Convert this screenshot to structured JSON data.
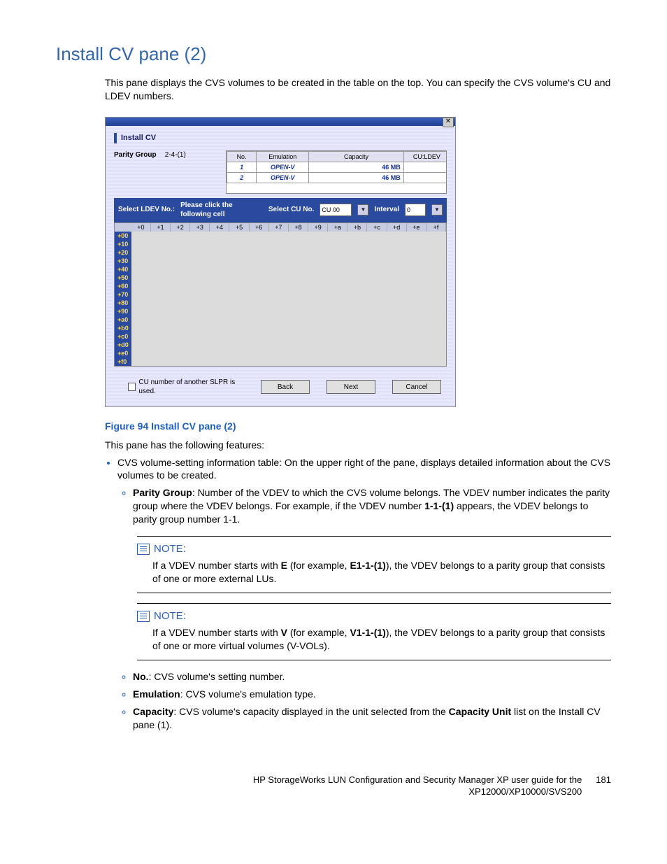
{
  "heading": "Install CV pane (2)",
  "intro": "This pane displays the CVS volumes to be created in the table on the top. You can specify the CVS volume's CU and LDEV numbers.",
  "dialog": {
    "title": "Install CV",
    "parity_label": "Parity Group",
    "parity_value": "2-4-(1)",
    "cols": {
      "no": "No.",
      "emu": "Emulation",
      "cap": "Capacity",
      "culdev": "CU:LDEV"
    },
    "rows": [
      {
        "no": "1",
        "emu": "OPEN-V",
        "cap": "46 MB",
        "culdev": ""
      },
      {
        "no": "2",
        "emu": "OPEN-V",
        "cap": "46 MB",
        "culdev": ""
      }
    ],
    "select_ldev_label": "Select LDEV No.:",
    "click_cell": "Please click the following cell",
    "select_cu_label": "Select CU No.",
    "cu_value": "CU 00",
    "interval_label": "Interval",
    "interval_value": "0",
    "col_offsets": [
      "+0",
      "+1",
      "+2",
      "+3",
      "+4",
      "+5",
      "+6",
      "+7",
      "+8",
      "+9",
      "+a",
      "+b",
      "+c",
      "+d",
      "+e",
      "+f"
    ],
    "row_offsets": [
      "+00",
      "+10",
      "+20",
      "+30",
      "+40",
      "+50",
      "+60",
      "+70",
      "+80",
      "+90",
      "+a0",
      "+b0",
      "+c0",
      "+d0",
      "+e0",
      "+f0"
    ],
    "chk_label": "CU number of another SLPR is used.",
    "btn_back": "Back",
    "btn_next": "Next",
    "btn_cancel": "Cancel"
  },
  "figcap": "Figure 94 Install CV pane (2)",
  "features_lead": "This pane has the following features:",
  "bul_cvs_info": "CVS volume-setting information table: On the upper right of the pane, displays detailed information about the CVS volumes to be created.",
  "pg_label": "Parity Group",
  "pg_rest1": ": Number of the VDEV to which the CVS volume belongs. The VDEV number indicates the parity group where the VDEV belongs. For example, if the VDEV number ",
  "pg_bold": "1-1-(1)",
  "pg_rest2": " appears, the VDEV belongs to parity group number 1-1.",
  "note_label": "NOTE:",
  "note1a": "If a VDEV number starts with ",
  "note1b": "E",
  "note1c": " (for example, ",
  "note1d": "E1-1-(1)",
  "note1e": "), the VDEV belongs to a parity group that consists of one or more external LUs.",
  "note2a": "If a VDEV number starts with ",
  "note2b": "V",
  "note2c": " (for example, ",
  "note2d": "V1-1-(1)",
  "note2e": "), the VDEV belongs to a parity group that consists of one or more virtual volumes (V-VOLs).",
  "li_no_b": "No.",
  "li_no_r": ": CVS volume's setting number.",
  "li_em_b": "Emulation",
  "li_em_r": ": CVS volume's emulation type.",
  "li_cap_b": "Capacity",
  "li_cap_r1": ": CVS volume's capacity displayed in the unit selected from the ",
  "li_cap_b2": "Capacity Unit",
  "li_cap_r2": " list on the Install CV pane (1).",
  "footer_text": "HP StorageWorks LUN Configuration and Security Manager XP user guide for the XP12000/XP10000/SVS200",
  "page_no": "181"
}
